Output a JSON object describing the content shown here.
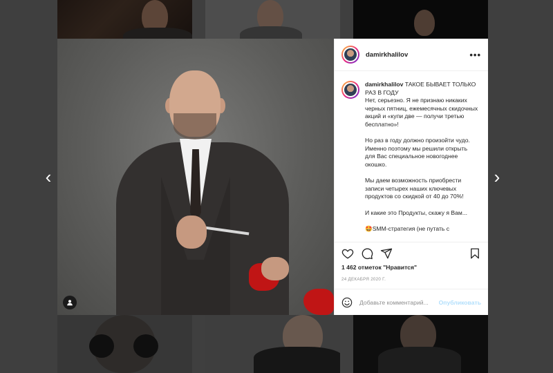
{
  "post": {
    "username": "damirkhalilov",
    "more_icon": "more-dots-icon",
    "caption": {
      "headline": "ТАКОЕ БЫВАЕТ ТОЛЬКО РАЗ В ГОДУ",
      "paragraphs": [
        "Нет, серьезно. Я не признаю никаких черных пятниц, ежемесячных скидочных акций и «купи две — получи третью бесплатно»!",
        "Но раз в году должно произойти чудо. Именно поэтому мы решили открыть для Вас специальное новогоднее окошко.",
        "Мы даем возможность приобрести записи четырех наших ключевых продуктов со скидкой от 40 до 70%!",
        "И какие это Продукты, скажу я Вам...",
        "🤩SMM-стратегия (не путать с"
      ]
    },
    "likes_text": "1 462 отметок \"Нравится\"",
    "date_text": "24 ДЕКАБРЯ 2020 Г.",
    "comment": {
      "placeholder": "Добавьте комментарий...",
      "publish_label": "Опубликовать"
    }
  },
  "navigation": {
    "prev_glyph": "‹",
    "next_glyph": "›"
  },
  "colors": {
    "publish_disabled": "#b2dffc",
    "text": "#262626",
    "muted": "#8e8e8e",
    "glove_red": "#c01515"
  }
}
